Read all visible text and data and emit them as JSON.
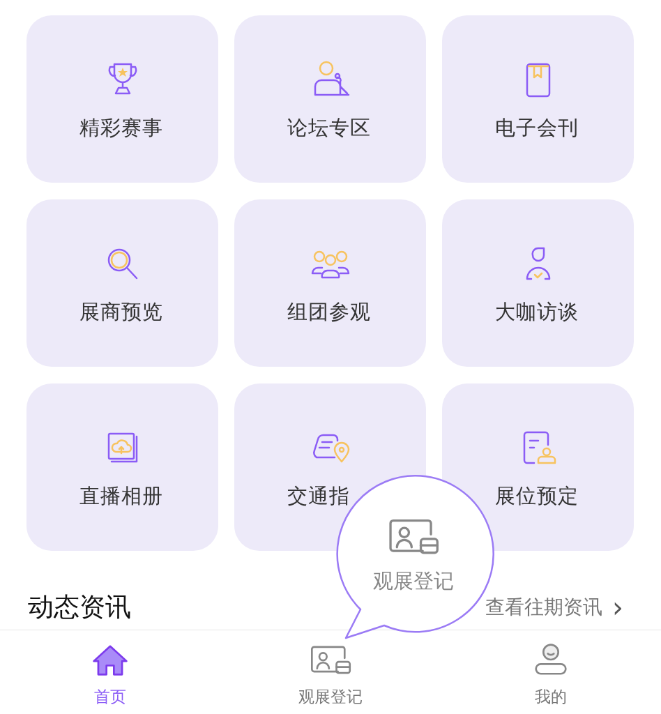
{
  "grid": [
    {
      "label": "精彩赛事",
      "kind": "trophy"
    },
    {
      "label": "论坛专区",
      "kind": "speaker"
    },
    {
      "label": "电子会刊",
      "kind": "book"
    },
    {
      "label": "展商预览",
      "kind": "search"
    },
    {
      "label": "组团参观",
      "kind": "group"
    },
    {
      "label": "大咖访谈",
      "kind": "person"
    },
    {
      "label": "直播相册",
      "kind": "album"
    },
    {
      "label": "交通指",
      "kind": "route"
    },
    {
      "label": "展位预定",
      "kind": "booth"
    }
  ],
  "news": {
    "title": "动态资讯",
    "link": "查看往期资讯",
    "chevron": "›"
  },
  "tooltip": {
    "label": "观展登记"
  },
  "tabs": [
    {
      "label": "首页",
      "kind": "home",
      "selected": true
    },
    {
      "label": "观展登记",
      "kind": "register",
      "selected": false
    },
    {
      "label": "我的",
      "kind": "profile",
      "selected": false
    }
  ]
}
